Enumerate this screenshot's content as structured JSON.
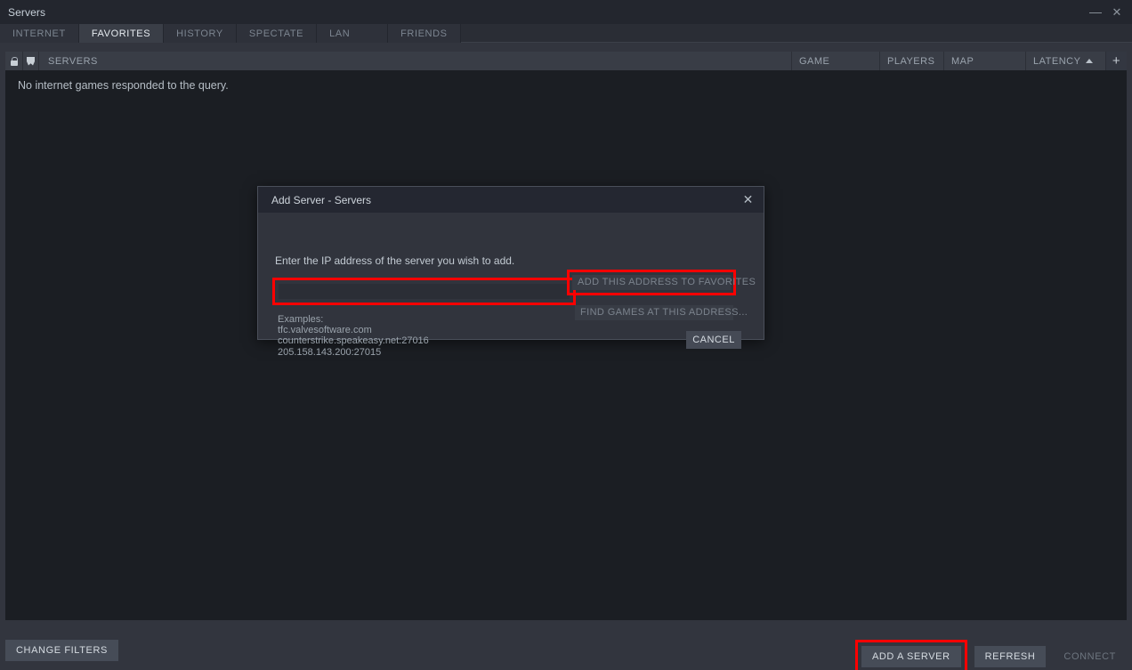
{
  "window": {
    "title": "Servers",
    "minimize_label": "—",
    "close_label": "✕"
  },
  "tabs": [
    {
      "label": "INTERNET",
      "active": false
    },
    {
      "label": "FAVORITES",
      "active": true
    },
    {
      "label": "HISTORY",
      "active": false
    },
    {
      "label": "SPECTATE",
      "active": false
    },
    {
      "label": "LAN",
      "active": false
    },
    {
      "label": "FRIENDS",
      "active": false
    }
  ],
  "columns": {
    "lock_icon": "lock-icon",
    "shield_icon": "shield-icon",
    "servers": "SERVERS",
    "game": "GAME",
    "players": "PLAYERS",
    "map": "MAP",
    "latency": "LATENCY",
    "latency_sort": "ascending",
    "add_column": "+"
  },
  "list": {
    "empty_message": "No internet games responded to the query.",
    "rows": []
  },
  "footer": {
    "change_filters": "CHANGE FILTERS",
    "add_a_server": "ADD A SERVER",
    "refresh": "REFRESH",
    "connect": "CONNECT",
    "connect_disabled": true
  },
  "dialog": {
    "title": "Add Server - Servers",
    "close_label": "✕",
    "prompt": "Enter the IP address of the server you wish to add.",
    "input_value": "",
    "input_placeholder": "",
    "examples_label": "Examples:",
    "examples": [
      "tfc.valvesoftware.com",
      "counterstrike.speakeasy.net:27016",
      "205.158.143.200:27015"
    ],
    "add_to_favorites": "ADD THIS ADDRESS TO FAVORITES",
    "find_games": "FIND GAMES AT THIS ADDRESS...",
    "cancel": "CANCEL"
  },
  "highlight_color": "#ff0000"
}
